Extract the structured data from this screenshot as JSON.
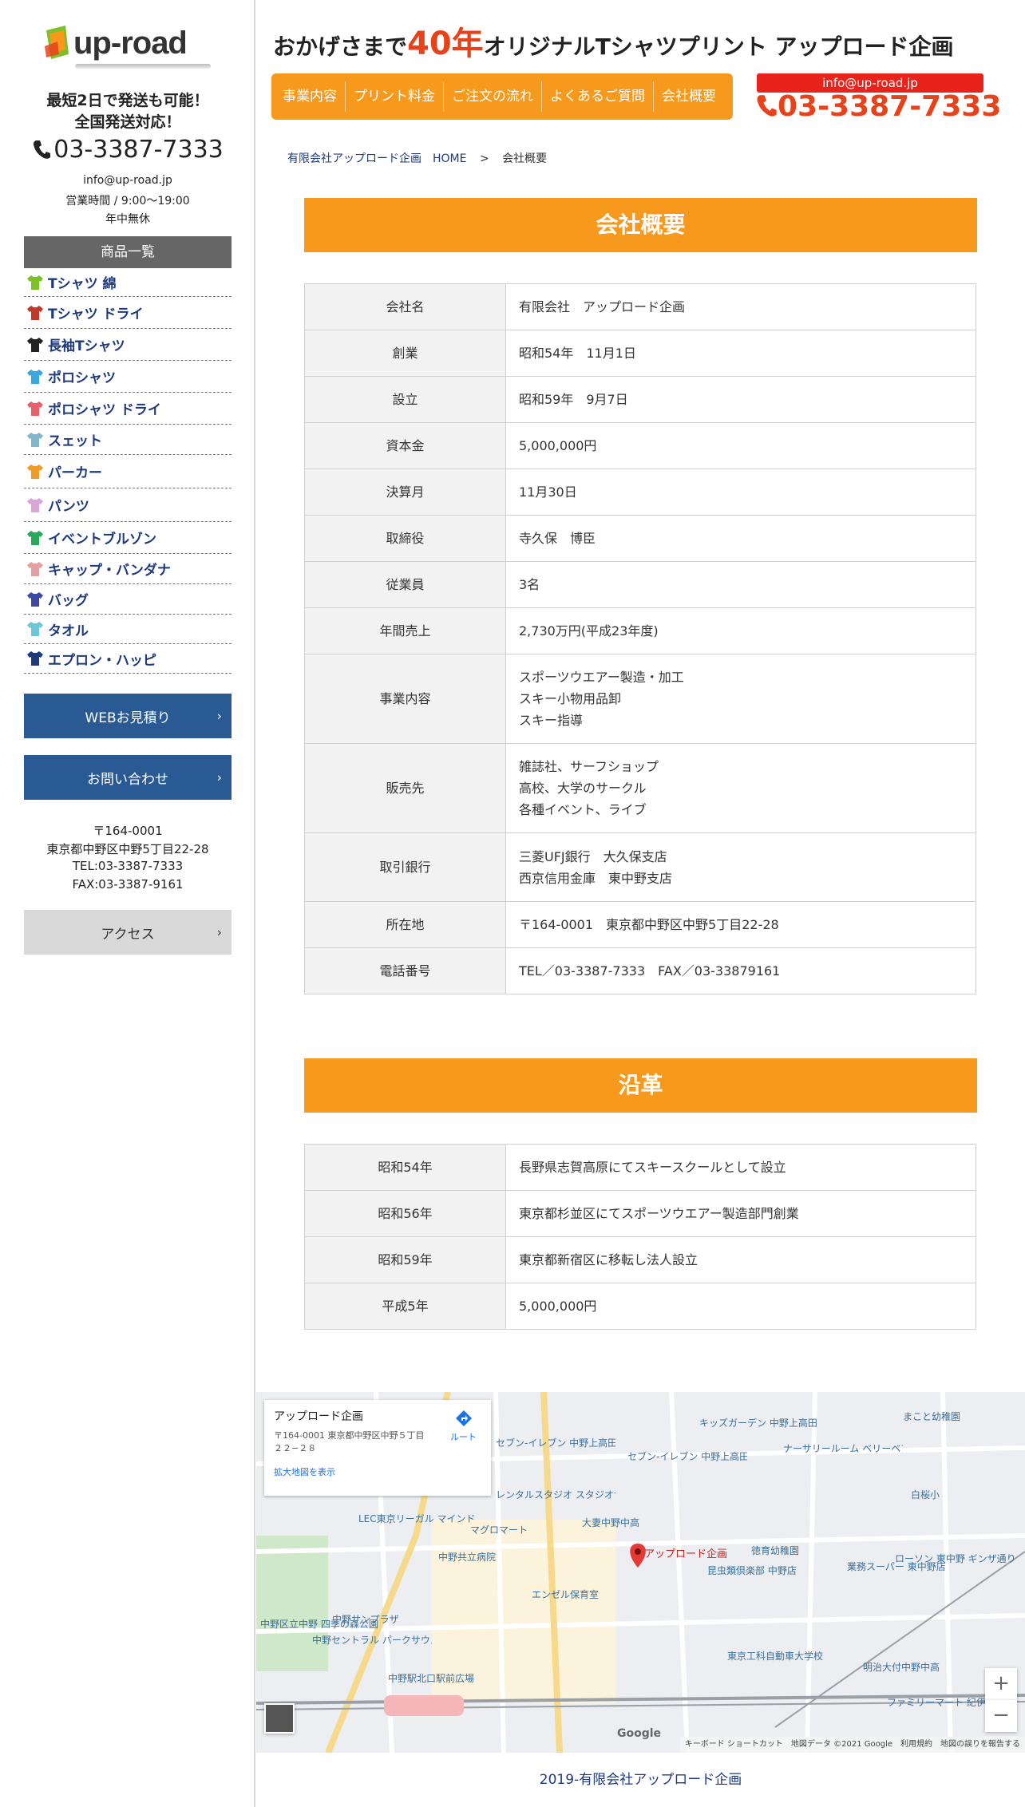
{
  "sidebar": {
    "logo_text": "up-road",
    "catch_line1": "最短2日で発送も可能！",
    "catch_line2": "全国発送対応！",
    "phone": "03-3387-7333",
    "email": "info@up-road.jp",
    "hours": "営業時間 / 9:00～19:00",
    "open": "年中無休",
    "product_header": "商品一覧",
    "products": [
      {
        "label": "Tシャツ 綿",
        "icon": "tshirt-icon",
        "color": "#7cc12a"
      },
      {
        "label": "Tシャツ ドライ",
        "icon": "tshirt-icon",
        "color": "#c0392b"
      },
      {
        "label": "長袖Tシャツ",
        "icon": "longsleeve-icon",
        "color": "#222222"
      },
      {
        "label": "ポロシャツ",
        "icon": "polo-icon",
        "color": "#3aa7e0"
      },
      {
        "label": "ポロシャツ ドライ",
        "icon": "polo-icon",
        "color": "#e8606a"
      },
      {
        "label": "スェット",
        "icon": "sweat-icon",
        "color": "#7fb6c9"
      },
      {
        "label": "パーカー",
        "icon": "hoodie-icon",
        "color": "#f09a2a"
      },
      {
        "label": "パンツ",
        "icon": "pants-icon",
        "color": "#d8a6d8"
      },
      {
        "label": "イベントブルゾン",
        "icon": "jacket-icon",
        "color": "#2aa85a"
      },
      {
        "label": "キャップ・バンダナ",
        "icon": "cap-icon",
        "color": "#e3a0a0"
      },
      {
        "label": "バッグ",
        "icon": "bag-icon",
        "color": "#3a4aa0"
      },
      {
        "label": "タオル",
        "icon": "towel-icon",
        "color": "#6cc6d6"
      },
      {
        "label": "エプロン・ハッピ",
        "icon": "apron-icon",
        "color": "#1f3a7a"
      }
    ],
    "estimate_btn": "WEBお見積り",
    "contact_btn": "お問い合わせ",
    "postal": "〒164-0001",
    "address": "東京都中野区中野5丁目22-28",
    "tel": "TEL:03-3387-7333",
    "fax": "FAX:03-3387-9161",
    "access_btn": "アクセス"
  },
  "header": {
    "title_prefix": "おかげさまで",
    "title_years": "40年",
    "title_suffix": "オリジナルTシャツプリント アップロード企画",
    "nav": [
      "事業内容",
      "プリント料金",
      "ご注文の流れ",
      "よくあるご質問",
      "会社概要"
    ],
    "email": "info@up-road.jp",
    "phone": "03-3387-7333"
  },
  "breadcrumb": {
    "home": "有限会社アップロード企画　HOME",
    "sep": ">",
    "current": "会社概要"
  },
  "company": {
    "heading": "会社概要",
    "rows": [
      {
        "label": "会社名",
        "lines": [
          "有限会社　アップロード企画"
        ]
      },
      {
        "label": "創業",
        "lines": [
          "昭和54年　11月1日"
        ]
      },
      {
        "label": "設立",
        "lines": [
          "昭和59年　9月7日"
        ]
      },
      {
        "label": "資本金",
        "lines": [
          "5,000,000円"
        ]
      },
      {
        "label": "決算月",
        "lines": [
          "11月30日"
        ]
      },
      {
        "label": "取締役",
        "lines": [
          "寺久保　博臣"
        ]
      },
      {
        "label": "従業員",
        "lines": [
          "3名"
        ]
      },
      {
        "label": "年間売上",
        "lines": [
          "2,730万円(平成23年度)"
        ]
      },
      {
        "label": "事業内容",
        "lines": [
          "スポーツウエアー製造・加工",
          "スキー小物用品卸",
          "スキー指導"
        ]
      },
      {
        "label": "販売先",
        "lines": [
          "雑誌社、サーフショップ",
          "高校、大学のサークル",
          "各種イベント、ライブ"
        ]
      },
      {
        "label": "取引銀行",
        "lines": [
          "三菱UFJ銀行　大久保支店",
          "西京信用金庫　東中野支店"
        ]
      },
      {
        "label": "所在地",
        "lines": [
          "〒164-0001　東京都中野区中野5丁目22-28"
        ]
      },
      {
        "label": "電話番号",
        "lines": [
          "TEL／03-3387-7333　FAX／03-33879161"
        ]
      }
    ]
  },
  "history": {
    "heading": "沿革",
    "rows": [
      {
        "label": "昭和54年",
        "lines": [
          "長野県志賀高原にてスキースクールとして設立"
        ]
      },
      {
        "label": "昭和56年",
        "lines": [
          "東京都杉並区にてスポーツウエアー製造部門創業"
        ]
      },
      {
        "label": "昭和59年",
        "lines": [
          "東京都新宿区に移転し法人設立"
        ]
      },
      {
        "label": "平成5年",
        "lines": [
          "5,000,000円"
        ]
      }
    ]
  },
  "map": {
    "card_title": "アップロード企画",
    "card_address_1": "〒164-0001 東京都中野区中野５丁目",
    "card_address_2": "２２−２８",
    "route_label": "ルート",
    "enlarge_link": "拡大地図を表示",
    "marker_label": "アップロード企画",
    "labels": [
      {
        "text": "キッズガーデン 中野上高田"
      },
      {
        "text": "セブン-イレブン 中野上高田店"
      },
      {
        "text": "セブン-イレブン 中野上高田2丁目東店"
      },
      {
        "text": "ナーサリールーム ベリーベアー中野"
      },
      {
        "text": "レンタルスタジオ スタジオサイ"
      },
      {
        "text": "大妻中野中高"
      },
      {
        "text": "マグロマート"
      },
      {
        "text": "LEC東京リーガル マインド 中野本校"
      },
      {
        "text": "中野共立病院"
      },
      {
        "text": "徳育幼稚園"
      },
      {
        "text": "昆虫類倶楽部 中野店"
      },
      {
        "text": "業務スーパー 東中野店"
      },
      {
        "text": "エンゼル保育室"
      },
      {
        "text": "中野サンプラザ"
      },
      {
        "text": "中野セントラル パークサウス"
      },
      {
        "text": "中野駅北口駅前広場"
      },
      {
        "text": "東京工科自動車大学校"
      },
      {
        "text": "明治大付中野中高"
      },
      {
        "text": "中野区立中野 四季の森公園"
      },
      {
        "text": "まこと幼稚園"
      },
      {
        "text": "白桜小"
      },
      {
        "text": "ローソン 東中野 ギンザ通り店"
      },
      {
        "text": "ファミリーマート 紀伊 國屋中野一丁目店"
      }
    ],
    "zoom_in": "+",
    "zoom_out": "−",
    "attribution": "キーボード ショートカット　地図データ ©2021 Google　利用規約　地図の誤りを報告する",
    "google": "Google"
  },
  "footer": {
    "copyright": "2019-有限会社アップロード企画"
  },
  "colors": {
    "orange": "#f7991c",
    "red": "#e8421b",
    "navy": "#1f3a7a",
    "button_blue": "#2a5a93"
  }
}
